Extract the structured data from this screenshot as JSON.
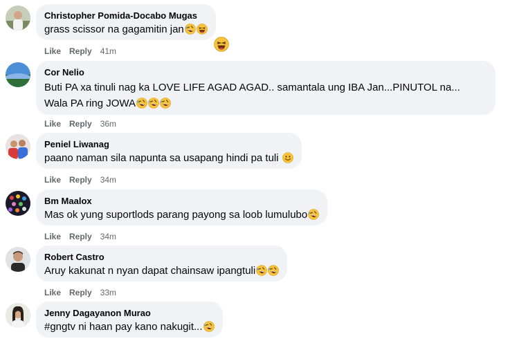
{
  "comments": [
    {
      "author": "Christopher Pomida-Docabo Mugas",
      "text": "grass scissor na gagamitin jan",
      "emojis": [
        "rofl-emoji",
        "laugh-emoji"
      ],
      "reaction": "laugh-emoji",
      "like": "Like",
      "reply": "Reply",
      "time": "41m"
    },
    {
      "author": "Cor Nelio",
      "text_line1": "Buti PA xa tinuli nag ka LOVE LIFE AGAD AGAD.. samantala ung IBA Jan...PINUTOL na...",
      "text_line2": "Wala PA ring JOWA",
      "emojis": [
        "rofl-emoji",
        "rofl-emoji",
        "rofl-emoji"
      ],
      "like": "Like",
      "reply": "Reply",
      "time": "36m"
    },
    {
      "author": "Peniel Liwanag",
      "text": "paano naman sila napunta sa usapang hindi pa tuli",
      "emojis": [
        "smile-emoji"
      ],
      "like": "Like",
      "reply": "Reply",
      "time": "34m"
    },
    {
      "author": "Bm Maalox",
      "text": "Mas ok yung suportlods parang payong sa loob lumulubo",
      "emojis": [
        "rofl-emoji"
      ],
      "like": "Like",
      "reply": "Reply",
      "time": "34m"
    },
    {
      "author": "Robert Castro",
      "text": "Aruy kakunat n nyan dapat chainsaw ipangtuli",
      "emojis": [
        "rofl-emoji",
        "rofl-emoji"
      ],
      "like": "Like",
      "reply": "Reply",
      "time": "33m"
    },
    {
      "author": "Jenny Dagayanon Murao",
      "text": "#gngtv ni haan pay kano nakugit...",
      "emojis": [
        "rofl-emoji"
      ]
    }
  ]
}
